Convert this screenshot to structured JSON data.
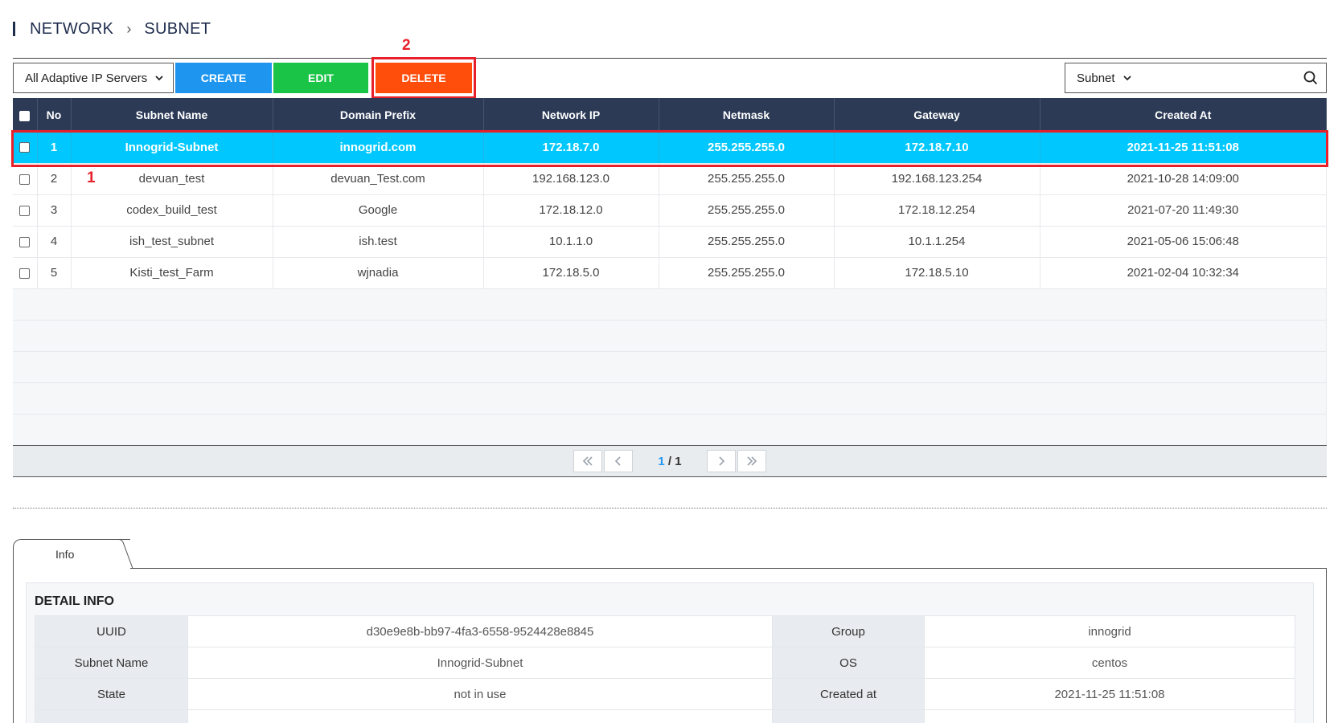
{
  "breadcrumb": {
    "level1": "NETWORK",
    "separator": "›",
    "level2": "SUBNET"
  },
  "toolbar": {
    "server_select": "All Adaptive IP Servers",
    "create_label": "CREATE",
    "edit_label": "EDIT",
    "delete_label": "DELETE"
  },
  "annotations": {
    "row_marker": "1",
    "button_marker": "2"
  },
  "search": {
    "field_select": "Subnet",
    "value": ""
  },
  "table": {
    "columns": [
      "No",
      "Subnet Name",
      "Domain Prefix",
      "Network IP",
      "Netmask",
      "Gateway",
      "Created At"
    ],
    "rows": [
      {
        "no": "1",
        "name": "Innogrid-Subnet",
        "domain": "innogrid.com",
        "network_ip": "172.18.7.0",
        "netmask": "255.255.255.0",
        "gateway": "172.18.7.10",
        "created": "2021-11-25 11:51:08"
      },
      {
        "no": "2",
        "name": "devuan_test",
        "domain": "devuan_Test.com",
        "network_ip": "192.168.123.0",
        "netmask": "255.255.255.0",
        "gateway": "192.168.123.254",
        "created": "2021-10-28 14:09:00"
      },
      {
        "no": "3",
        "name": "codex_build_test",
        "domain": "Google",
        "network_ip": "172.18.12.0",
        "netmask": "255.255.255.0",
        "gateway": "172.18.12.254",
        "created": "2021-07-20 11:49:30"
      },
      {
        "no": "4",
        "name": "ish_test_subnet",
        "domain": "ish.test",
        "network_ip": "10.1.1.0",
        "netmask": "255.255.255.0",
        "gateway": "10.1.1.254",
        "created": "2021-05-06 15:06:48"
      },
      {
        "no": "5",
        "name": "Kisti_test_Farm",
        "domain": "wjnadia",
        "network_ip": "172.18.5.0",
        "netmask": "255.255.255.0",
        "gateway": "172.18.5.10",
        "created": "2021-02-04 10:32:34"
      }
    ]
  },
  "pagination": {
    "current": "1",
    "separator": " / ",
    "total": "1"
  },
  "detail": {
    "tab_label": "Info",
    "title": "DETAIL INFO",
    "rows": [
      {
        "k1": "UUID",
        "v1": "d30e9e8b-bb97-4fa3-6558-9524428e8845",
        "k2": "Group",
        "v2": "innogrid"
      },
      {
        "k1": "Subnet Name",
        "v1": "Innogrid-Subnet",
        "k2": "OS",
        "v2": "centos"
      },
      {
        "k1": "State",
        "v1": "not in use",
        "k2": "Created at",
        "v2": "2021-11-25 11:51:08"
      }
    ]
  },
  "colors": {
    "accent_blue": "#1e96f0",
    "edit_green": "#19c447",
    "delete_orange": "#ff4e0c",
    "selected_row": "#00c8ff",
    "header_navy": "#2c3a56",
    "annotation_red": "#e8202a"
  }
}
